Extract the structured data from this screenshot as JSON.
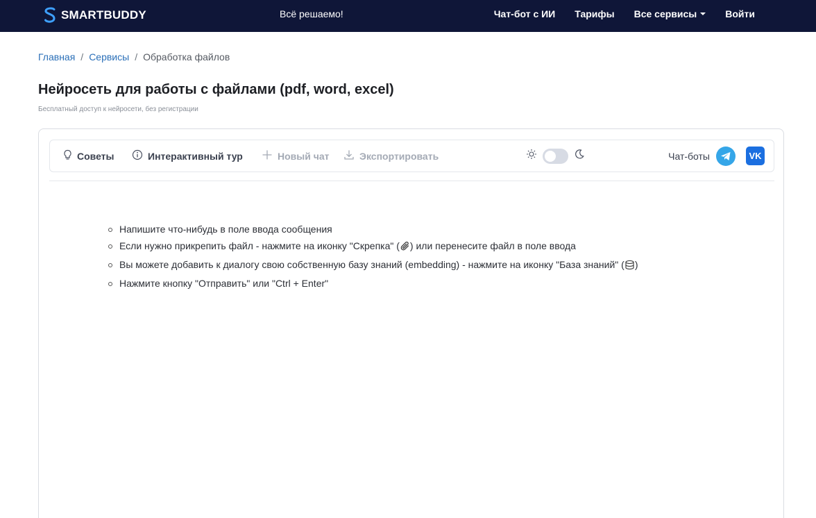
{
  "navbar": {
    "logo_text": "SMARTBUDDY",
    "slogan": "Всё решаемо!",
    "links": [
      "Чат-бот с ИИ",
      "Тарифы",
      "Все сервисы",
      "Войти"
    ],
    "bg_color": "#0f1638"
  },
  "breadcrumb": {
    "home": "Главная",
    "services": "Сервисы",
    "current": "Обработка файлов",
    "separator": "/"
  },
  "page": {
    "title": "Нейросеть для работы с файлами (pdf, word, excel)",
    "subtitle": "Бесплатный доступ к нейросети, без регистрации"
  },
  "toolbar": {
    "tips": "Советы",
    "tour": "Интерактивный тур",
    "new_chat": "Новый чат",
    "export": "Экспортировать",
    "bots_label": "Чат-боты",
    "vk_text": "VK",
    "theme_dark": false
  },
  "hints": {
    "h1": "Напишите что-нибудь в поле ввода сообщения",
    "h2_a": "Если нужно прикрепить файл - нажмите на иконку \"Скрепка\" (",
    "h2_b": ") или перенесите файл в поле ввода",
    "h3_a": "Вы можете добавить к диалогу свою собственную базу знаний (embedding) - нажмите на иконку \"База знаний\" (",
    "h3_b": ")",
    "h4": "Нажмите кнопку \"Отправить\" или \"Ctrl + Enter\""
  },
  "icons": [
    "logo-icon",
    "lightbulb-icon",
    "info-icon",
    "plus-icon",
    "download-icon",
    "sun-icon",
    "moon-icon",
    "telegram-icon",
    "vk-icon",
    "paperclip-icon",
    "database-icon",
    "caret-down-icon"
  ]
}
